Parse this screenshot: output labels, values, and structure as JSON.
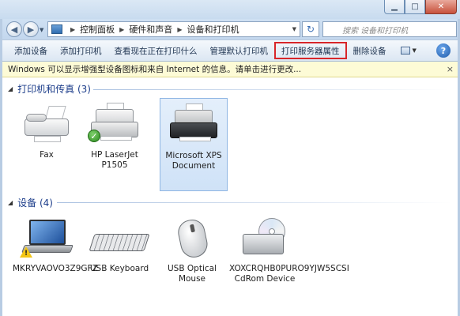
{
  "window": {
    "minimize_icon": "minimize-icon",
    "maximize_icon": "maximize-icon",
    "close_icon": "close-icon"
  },
  "nav": {
    "back_glyph": "◀",
    "forward_glyph": "▶",
    "breadcrumbs": [
      "控制面板",
      "硬件和声音",
      "设备和打印机"
    ],
    "refresh_glyph": "↻",
    "search_placeholder": "搜索 设备和打印机"
  },
  "toolbar": {
    "add_device": "添加设备",
    "add_printer": "添加打印机",
    "see_printing": "查看现在正在打印什么",
    "set_default": "管理默认打印机",
    "server_properties": "打印服务器属性",
    "remove_device": "删除设备",
    "help_glyph": "?"
  },
  "infobar": {
    "text": "Windows 可以显示增强型设备图标和来自 Internet 的信息。请单击进行更改...",
    "close_glyph": "×"
  },
  "groups": {
    "printers": {
      "title": "打印机和传真 (3)",
      "items": [
        {
          "label": "Fax"
        },
        {
          "label": "HP LaserJet P1505"
        },
        {
          "label": "Microsoft XPS Document"
        }
      ]
    },
    "devices": {
      "title": "设备 (4)",
      "items": [
        {
          "label": "MKRYVAOVO3Z9GFZ"
        },
        {
          "label": "USB Keyboard"
        },
        {
          "label": "USB Optical Mouse"
        },
        {
          "label": "XOXCRQHB0PURO9YJW5SCSI CdRom Device"
        }
      ]
    }
  }
}
